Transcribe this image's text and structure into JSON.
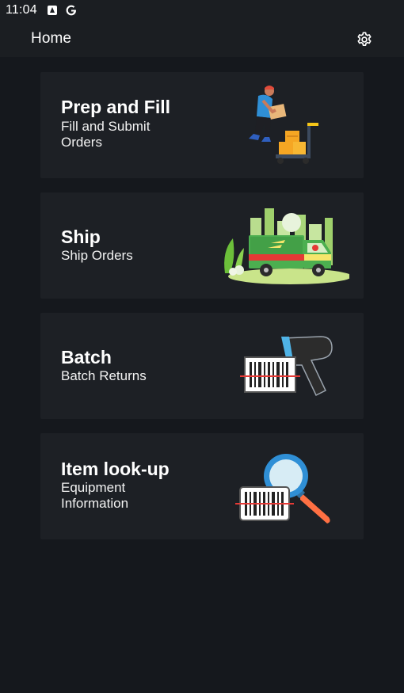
{
  "status_bar": {
    "time": "11:04",
    "icons": [
      "notification-icon",
      "google-g-icon"
    ]
  },
  "app_bar": {
    "title": "Home",
    "settings_icon": "gear-icon"
  },
  "cards": [
    {
      "title": "Prep and Fill",
      "subtitle": "Fill and Submit Orders",
      "illustration": "worker-with-boxes-icon"
    },
    {
      "title": "Ship",
      "subtitle": "Ship Orders",
      "illustration": "delivery-truck-icon"
    },
    {
      "title": "Batch",
      "subtitle": "Batch Returns",
      "illustration": "barcode-scanner-icon"
    },
    {
      "title": "Item look-up",
      "subtitle": "Equipment Information",
      "illustration": "magnifier-barcode-icon"
    }
  ],
  "colors": {
    "background": "#15181d",
    "bar": "#1b1e22",
    "card": "#1d2025",
    "accent_orange": "#f5a623",
    "accent_green": "#6cbf3a",
    "accent_blue": "#2f8fd6"
  }
}
